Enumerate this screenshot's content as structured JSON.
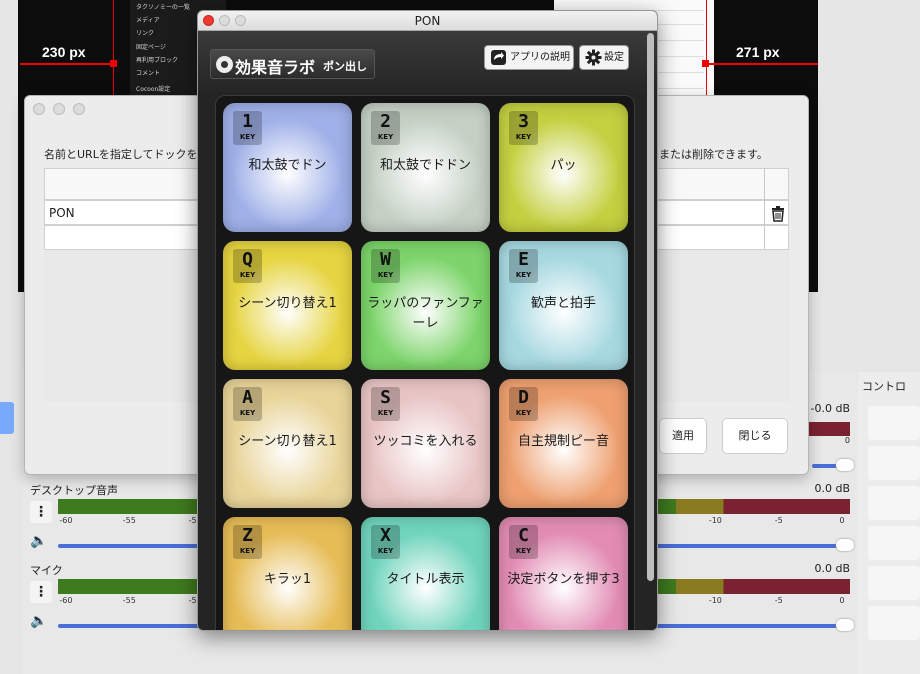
{
  "background": {
    "measure_left": "230 px",
    "measure_right": "271 px",
    "site_menu": [
      "タクソノミーの一覧",
      "メディア",
      "リンク",
      "固定ページ",
      "再利用ブロック",
      "コメント",
      "Cocoon設定"
    ],
    "mixer": {
      "channels": [
        {
          "name": "デスクトップ音声",
          "db": "0.0 dB"
        },
        {
          "name": "マイク",
          "db": "0.0 dB"
        }
      ],
      "top_db": "-0.0 dB",
      "top_zero": "0",
      "scale_ticks": [
        "-60",
        "-55",
        "-5",
        "-10",
        "-5",
        "0"
      ],
      "controls_title": "コントロ"
    }
  },
  "dock_dialog": {
    "desc_left": "名前とURLを指定してドックを",
    "desc_right": "または削除できます。",
    "row_name": "PON",
    "apply_label": "適用",
    "close_label": "閉じる"
  },
  "pon": {
    "window_title": "PON",
    "logo_main": "効果音ラボ",
    "logo_sub": "ポン出し",
    "help_label": "アプリの説明",
    "settings_label": "設定",
    "pads": [
      {
        "key": "1",
        "label": "和太鼓でドン",
        "color": "#9fb0e8"
      },
      {
        "key": "2",
        "label": "和太鼓でドドン",
        "color": "#c4d0c4"
      },
      {
        "key": "3",
        "label": "パッ",
        "color": "#c4d040"
      },
      {
        "key": "Q",
        "label": "シーン切り替え1",
        "color": "#e6d440"
      },
      {
        "key": "W",
        "label": "ラッパのファンファーレ",
        "color": "#7cd46a"
      },
      {
        "key": "E",
        "label": "歓声と拍手",
        "color": "#a6d8e0"
      },
      {
        "key": "A",
        "label": "シーン切り替え1",
        "color": "#e8d498"
      },
      {
        "key": "S",
        "label": "ツッコミを入れる",
        "color": "#e8c4c4"
      },
      {
        "key": "D",
        "label": "自主規制ピー音",
        "color": "#eea070"
      },
      {
        "key": "Z",
        "label": "キラッ1",
        "color": "#e6bc56"
      },
      {
        "key": "X",
        "label": "タイトル表示",
        "color": "#70d4bc"
      },
      {
        "key": "C",
        "label": "決定ボタンを押す3",
        "color": "#e28cb4"
      }
    ],
    "key_word": "KEY"
  }
}
